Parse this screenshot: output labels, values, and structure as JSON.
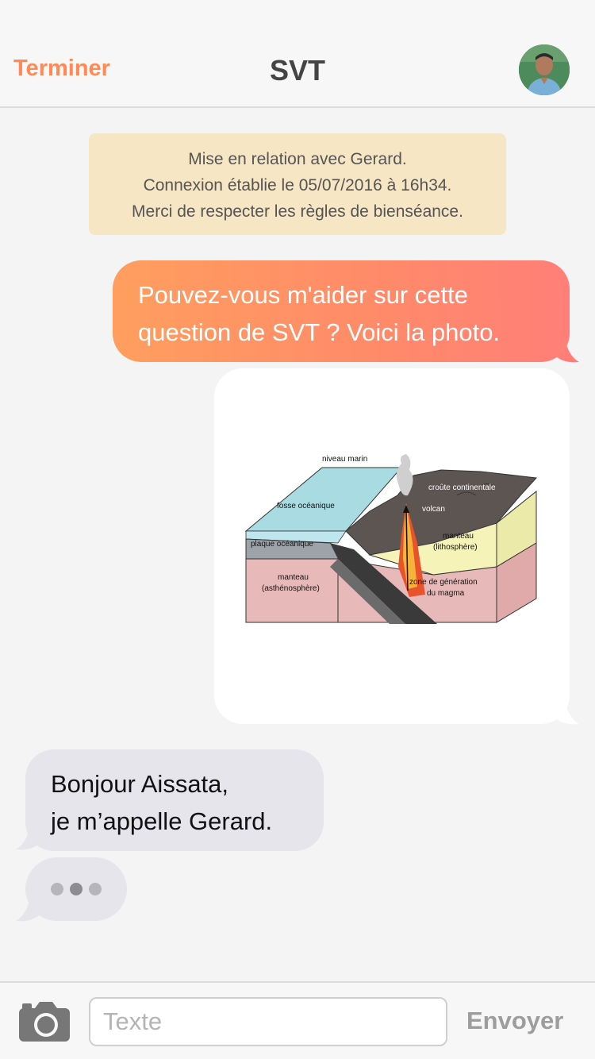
{
  "header": {
    "left_button": "Terminer",
    "title": "SVT"
  },
  "notice": {
    "lines": [
      "Mise en relation avec Gerard.",
      "Connexion établie le 05/07/2016 à 16h34.",
      "Merci de respecter les règles de bienséance."
    ]
  },
  "messages": {
    "outgoing_text": {
      "lines": [
        "Pouvez-vous m'aider sur cette",
        "question de SVT ? Voici la photo."
      ]
    },
    "outgoing_image": {
      "labels": {
        "niveau_marin": "niveau marin",
        "croute": "croûte continentale",
        "fosse": "fosse océanique",
        "volcan": "volcan",
        "plaque": "plaque océanique",
        "manteau_litho_1": "manteau",
        "manteau_litho_2": "(lithosphère)",
        "manteau_asth_1": "manteau",
        "manteau_asth_2": "(asthénosphère)",
        "zone_1": "zone de génération",
        "zone_2": "du magma"
      }
    },
    "incoming_text": {
      "lines": [
        "Bonjour Aissata,",
        "je m’appelle Gerard."
      ]
    }
  },
  "composer": {
    "placeholder": "Texte",
    "value": "",
    "send_label": "Envoyer",
    "camera_icon": "camera-icon"
  },
  "colors": {
    "accent": "#ff8a55",
    "outgoing_gradient_start": "#ff9e5e",
    "outgoing_gradient_end": "#ff7f78",
    "incoming_bubble": "#e6e5eb",
    "notice_bg": "#f7e6c3"
  }
}
